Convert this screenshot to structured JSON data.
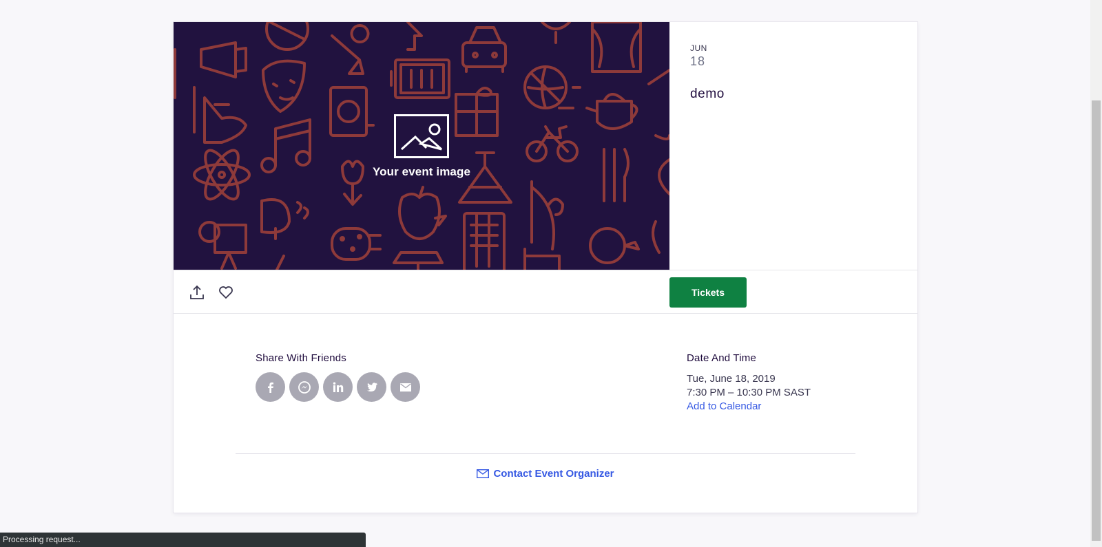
{
  "hero": {
    "caption": "Your event image",
    "background_color": "#21123f",
    "pattern_color": "#8e3a3a"
  },
  "summary": {
    "month": "JUN",
    "day": "18",
    "title": "demo"
  },
  "actions": {
    "share_icon": "share-icon",
    "like_icon": "heart-icon",
    "tickets_label": "Tickets",
    "tickets_color": "#0f8142"
  },
  "share": {
    "heading": "Share With Friends",
    "networks": [
      {
        "name": "facebook",
        "glyph": "f"
      },
      {
        "name": "messenger",
        "glyph": "m"
      },
      {
        "name": "linkedin",
        "glyph": "in"
      },
      {
        "name": "twitter",
        "glyph": "t"
      },
      {
        "name": "email",
        "glyph": "e"
      }
    ]
  },
  "date_time": {
    "heading": "Date And Time",
    "date": "Tue, June 18, 2019",
    "time": "7:30 PM – 10:30 PM SAST",
    "add_to_calendar": "Add to Calendar"
  },
  "contact": {
    "label": "Contact Event Organizer",
    "link_color": "#3659e3"
  },
  "status": {
    "text": "Processing request..."
  }
}
